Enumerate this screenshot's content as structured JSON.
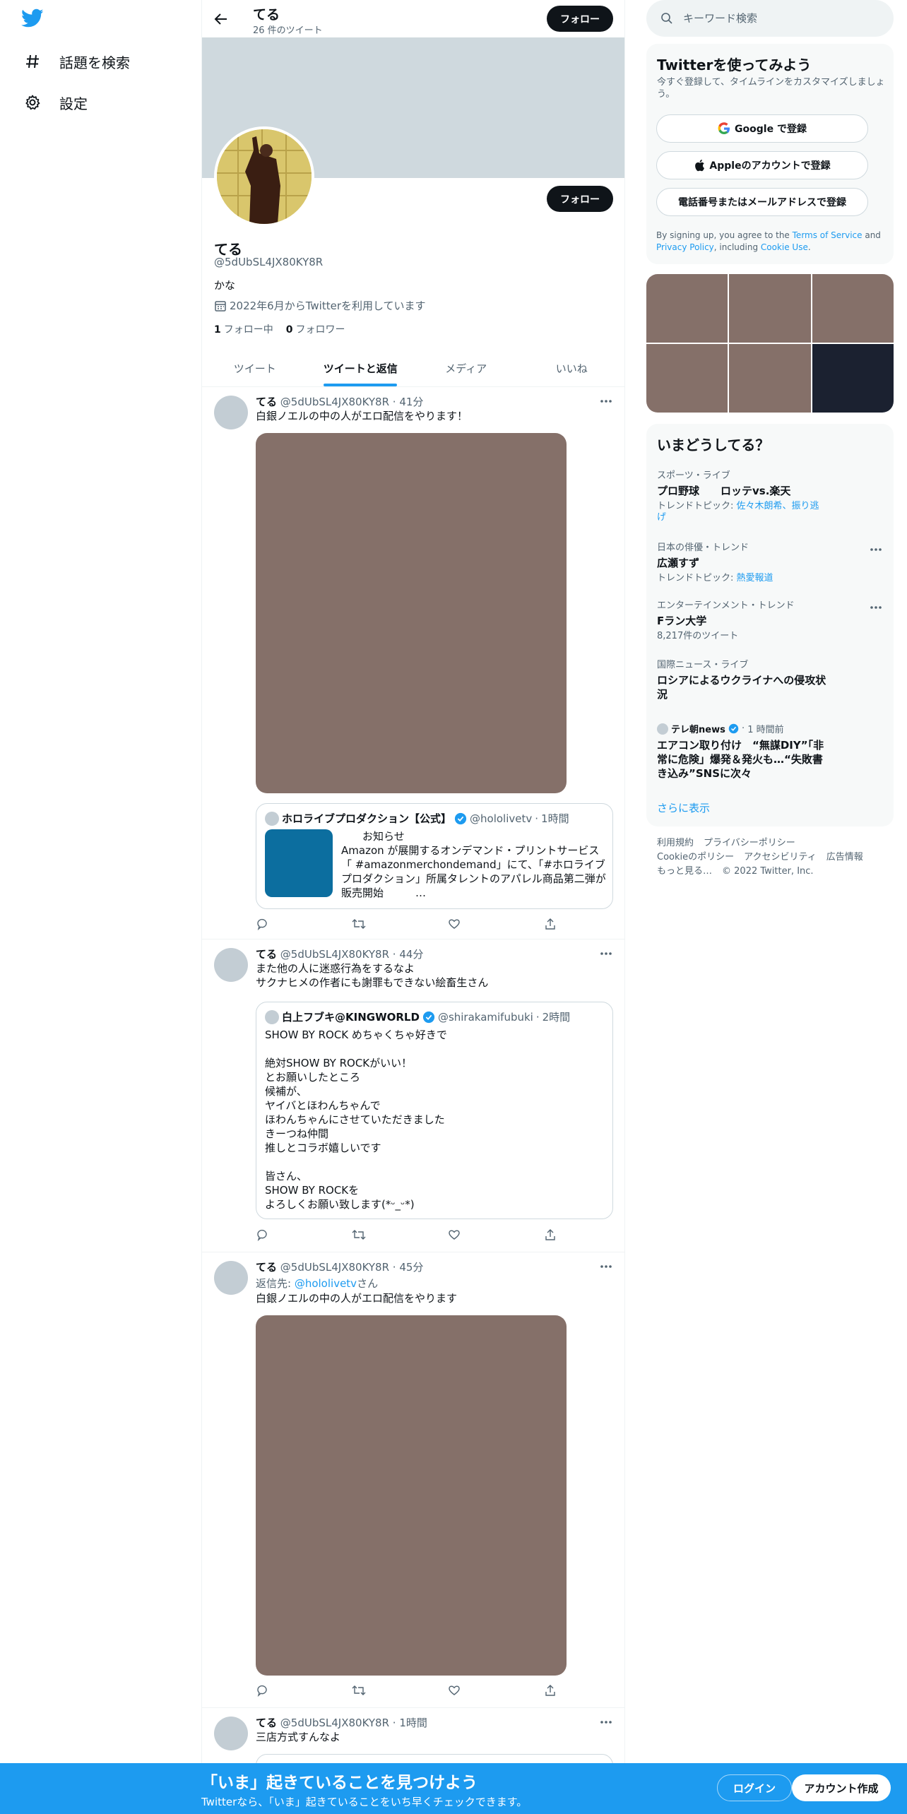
{
  "nav": {
    "logo_icon": "twitter-bird-icon",
    "items": [
      {
        "label": "話題を検索",
        "icon": "hashtag-icon"
      },
      {
        "label": "設定",
        "icon": "gear-icon"
      }
    ]
  },
  "header": {
    "name": "てる",
    "tweet_count": "26 件のツイート",
    "follow_label": "フォロー"
  },
  "profile": {
    "name": "てる",
    "handle": "@5dUbSL4JX80KY8R",
    "bio": "かな",
    "joined": "2022年6月からTwitterを利用しています",
    "following_count": "1",
    "following_label": "フォロー中",
    "followers_count": "0",
    "followers_label": "フォロワー",
    "follow_label": "フォロー"
  },
  "tabs": [
    {
      "label": "ツイート",
      "active": false
    },
    {
      "label": "ツイートと返信",
      "active": true
    },
    {
      "label": "メディア",
      "active": false
    },
    {
      "label": "いいね",
      "active": false
    }
  ],
  "tweets": [
    {
      "name": "てる",
      "handle": "@5dUbSL4JX80KY8R",
      "time": "41分",
      "text": "白銀ノエルの中の人がエロ配信をやります！",
      "quote": {
        "name": "ホロライブプロダクション【公式】",
        "handle": "@hololivetv",
        "time": "1時間",
        "text": "　　お知らせ\nAmazon が展開するオンデマンド・プリントサービス「 #amazonmerchondemand」にて、「#ホロライブプロダクション」所属タレントのアパレル商品第二弾が販売開始　　　…"
      }
    },
    {
      "name": "てる",
      "handle": "@5dUbSL4JX80KY8R",
      "time": "44分",
      "text": "また他の人に迷惑行為をするなよ\nサクナヒメの作者にも謝罪もできない絵畜生さん",
      "quote": {
        "name": "白上フブキ@KINGWORLD",
        "handle": "@shirakamifubuki",
        "time": "2時間",
        "text": "SHOW BY ROCK めちゃくちゃ好きで\n\n絶対SHOW BY ROCKがいい！\nとお願いしたところ\n候補が、\nヤイバとほわんちゃんで\nほわんちゃんにさせていただきました\nきーつね仲間\n推しとコラボ嬉しいです\n\n皆さん、\nSHOW BY ROCKを\nよろしくお願い致します(*ᵕ_ᵕ*)"
      }
    },
    {
      "name": "てる",
      "handle": "@5dUbSL4JX80KY8R",
      "time": "45分",
      "reply_prefix": "返信先: ",
      "reply_to": "@hololivetv",
      "reply_suffix": "さん",
      "text": "白銀ノエルの中の人がエロ配信をやります"
    },
    {
      "name": "てる",
      "handle": "@5dUbSL4JX80KY8R",
      "time": "1時間",
      "text": "三店方式すんなよ"
    }
  ],
  "search": {
    "placeholder": "キーワード検索"
  },
  "signup": {
    "title": "Twitterを使ってみよう",
    "subtitle": "今すぐ登録して、タイムラインをカスタマイズしましょう。",
    "google": "Google で登録",
    "apple": "Appleのアカウントで登録",
    "phone": "電話番号またはメールアドレスで登録",
    "legal_1": "By signing up, you agree to the ",
    "tos": "Terms of Service",
    "legal_2": " and ",
    "privacy": "Privacy Policy",
    "legal_3": ", including ",
    "cookie": "Cookie Use",
    "legal_4": "."
  },
  "trends": {
    "title": "いまどうしてる？",
    "items": [
      {
        "category": "スポーツ・ライブ",
        "name": "プロ野球　　ロッテvs.楽天",
        "sub_prefix": "トレンドトピック: ",
        "sub_link": "佐々木朗希、振り逃げ"
      },
      {
        "category": "日本の俳優・トレンド",
        "name": "広瀬すず",
        "sub_prefix": "トレンドトピック: ",
        "sub_link": "熱愛報道"
      },
      {
        "category": "エンターテインメント・トレンド",
        "name": "Fラン大学",
        "sub_prefix": "8,217件のツイート",
        "sub_link": ""
      },
      {
        "category": "国際ニュース・ライブ",
        "name": "ロシアによるウクライナへの侵攻状況",
        "sub_prefix": "",
        "sub_link": ""
      }
    ],
    "news": {
      "source": "テレ朝news",
      "time": "1 時間前",
      "headline": "エアコン取り付け　“無謀DIY”「非常に危険」爆発＆発火も…“失敗書き込み”SNSに次々"
    },
    "show_more": "さらに表示"
  },
  "footer": [
    "利用規約",
    "プライバシーポリシー",
    "Cookieのポリシー",
    "アクセシビリティ",
    "広告情報",
    "もっと見る…",
    "© 2022 Twitter, Inc."
  ],
  "bottom_bar": {
    "title": "「いま」起きていることを見つけよう",
    "subtitle": "Twitterなら、「いま」起きていることをいち早くチェックできます。",
    "login": "ログイン",
    "signup": "アカウント作成"
  }
}
